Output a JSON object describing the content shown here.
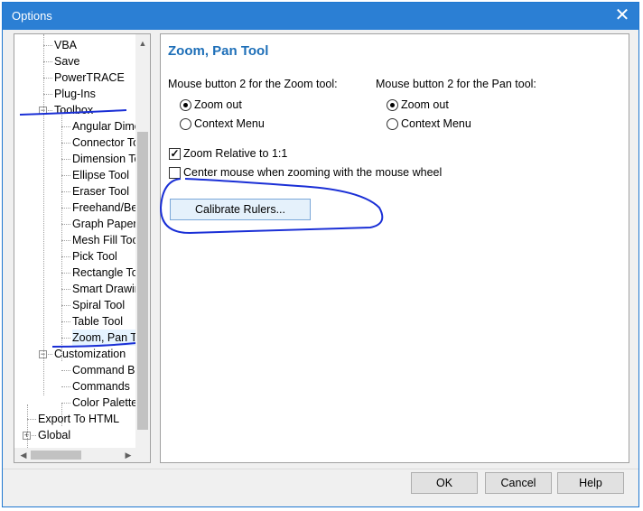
{
  "window": {
    "title": "Options",
    "close_glyph": "✕"
  },
  "tree": {
    "items": [
      {
        "label": "VBA"
      },
      {
        "label": "Save"
      },
      {
        "label": "PowerTRACE"
      },
      {
        "label": "Plug-Ins"
      },
      {
        "label": "Toolbox",
        "expander": "⊟"
      },
      {
        "label": "Angular Dime"
      },
      {
        "label": "Connector To"
      },
      {
        "label": "Dimension To"
      },
      {
        "label": "Ellipse Tool"
      },
      {
        "label": "Eraser Tool"
      },
      {
        "label": "Freehand/Be"
      },
      {
        "label": "Graph Paper"
      },
      {
        "label": "Mesh Fill Too"
      },
      {
        "label": "Pick Tool"
      },
      {
        "label": "Rectangle To"
      },
      {
        "label": "Smart Drawin"
      },
      {
        "label": "Spiral Tool"
      },
      {
        "label": "Table Tool"
      },
      {
        "label": "Zoom, Pan To",
        "selected": true
      },
      {
        "label": "Customization",
        "expander": "⊟"
      },
      {
        "label": "Command Ba"
      },
      {
        "label": "Commands"
      },
      {
        "label": "Color Palette"
      },
      {
        "label": "Export To HTML"
      },
      {
        "label": "Global",
        "expander": "⊞"
      }
    ],
    "scroll_up_icon": "▲",
    "scroll_left_icon": "◀",
    "scroll_right_icon": "▶"
  },
  "panel": {
    "heading": "Zoom, Pan Tool",
    "zoom_group_label": "Mouse button 2 for the Zoom tool:",
    "pan_group_label": "Mouse button 2 for the Pan tool:",
    "zoom_options": [
      {
        "label": "Zoom out",
        "checked": true
      },
      {
        "label": "Context Menu",
        "checked": false
      }
    ],
    "pan_options": [
      {
        "label": "Zoom out",
        "checked": true
      },
      {
        "label": "Context Menu",
        "checked": false
      }
    ],
    "zoom_relative": {
      "label": "Zoom Relative to 1:1",
      "checked": true,
      "mark": "✓"
    },
    "center_mouse": {
      "label": "Center mouse when zooming with the mouse wheel",
      "checked": false
    },
    "calibrate_button": "Calibrate Rulers..."
  },
  "footer": {
    "ok": "OK",
    "cancel": "Cancel",
    "help": "Help"
  },
  "colors": {
    "titlebar": "#2b7fd4",
    "heading": "#1e6fb8",
    "annotation_ink": "#1a2fd6"
  }
}
